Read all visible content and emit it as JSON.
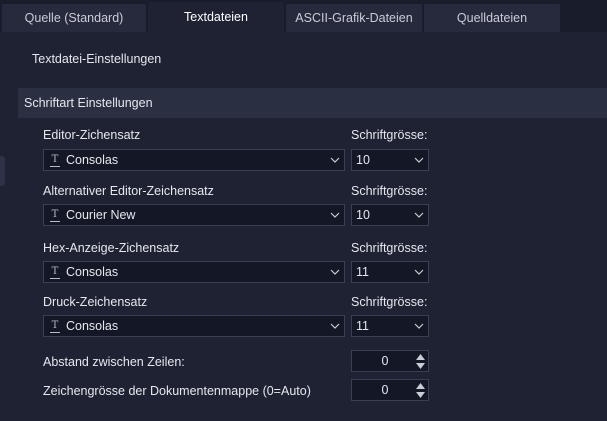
{
  "tabs": [
    {
      "label": "Quelle (Standard)",
      "active": false
    },
    {
      "label": "Textdateien",
      "active": true
    },
    {
      "label": "ASCII-Grafik-Dateien",
      "active": false
    },
    {
      "label": "Quelldateien",
      "active": false
    }
  ],
  "section_title": "Textdatei-Einstellungen",
  "group_title": "Schriftart Einstellungen",
  "font_rows": [
    {
      "label": "Editor-Zichensatz",
      "font": "Consolas",
      "size_label": "Schriftgrösse:",
      "size": "10"
    },
    {
      "label": "Alternativer Editor-Zeichensatz",
      "font": "Courier New",
      "size_label": "Schriftgrösse:",
      "size": "10"
    },
    {
      "label": "Hex-Anzeige-Zichensatz",
      "font": "Consolas",
      "size_label": "Schriftgrösse:",
      "size": "11"
    },
    {
      "label": "Druck-Zeichensatz",
      "font": "Consolas",
      "size_label": "Schriftgrösse:",
      "size": "11"
    }
  ],
  "line_spacing": {
    "label": "Abstand zwischen Zeilen:",
    "value": "0"
  },
  "doc_font_size": {
    "label": "Zeichengrösse der Dokumentenmappe (0=Auto)",
    "value": "0"
  },
  "icons": {
    "font": "font-icon",
    "dropdown": "chevron-down-icon",
    "up": "spin-up-icon",
    "down": "spin-down-icon"
  }
}
